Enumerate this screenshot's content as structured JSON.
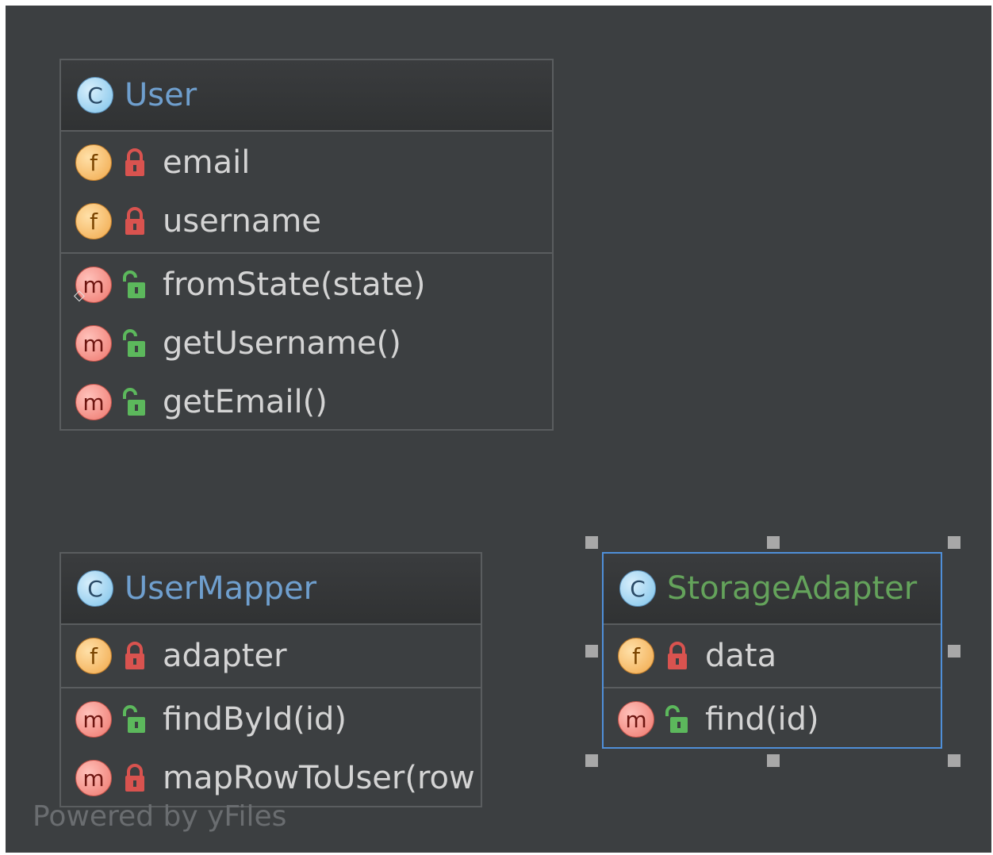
{
  "classes": [
    {
      "name": "User",
      "kind_icon": "class-icon",
      "kind_letter": "C",
      "fields": [
        {
          "badge": "f",
          "visibility": "private",
          "name": "email"
        },
        {
          "badge": "f",
          "visibility": "private",
          "name": "username"
        }
      ],
      "methods": [
        {
          "badge": "m",
          "visibility": "public",
          "name": "fromState(state)",
          "static": true
        },
        {
          "badge": "m",
          "visibility": "public",
          "name": "getUsername()"
        },
        {
          "badge": "m",
          "visibility": "public",
          "name": "getEmail()"
        }
      ]
    },
    {
      "name": "UserMapper",
      "kind_icon": "class-icon",
      "kind_letter": "C",
      "fields": [
        {
          "badge": "f",
          "visibility": "private",
          "name": "adapter"
        }
      ],
      "methods": [
        {
          "badge": "m",
          "visibility": "public",
          "name": "findById(id)"
        },
        {
          "badge": "m",
          "visibility": "private",
          "name": "mapRowToUser(row"
        }
      ]
    },
    {
      "name": "StorageAdapter",
      "kind_icon": "class-icon",
      "kind_letter": "C",
      "selected": true,
      "fields": [
        {
          "badge": "f",
          "visibility": "private",
          "name": "data"
        }
      ],
      "methods": [
        {
          "badge": "m",
          "visibility": "public",
          "name": "find(id)"
        }
      ]
    }
  ],
  "watermark": "Powered by yFiles",
  "colors": {
    "background": "#3c3f41",
    "class_name": "#6f9fce",
    "selected_class_name": "#64a35b",
    "private_lock": "#d9534f",
    "public_lock": "#5cb85c",
    "selection_border": "#4f8fd8"
  }
}
